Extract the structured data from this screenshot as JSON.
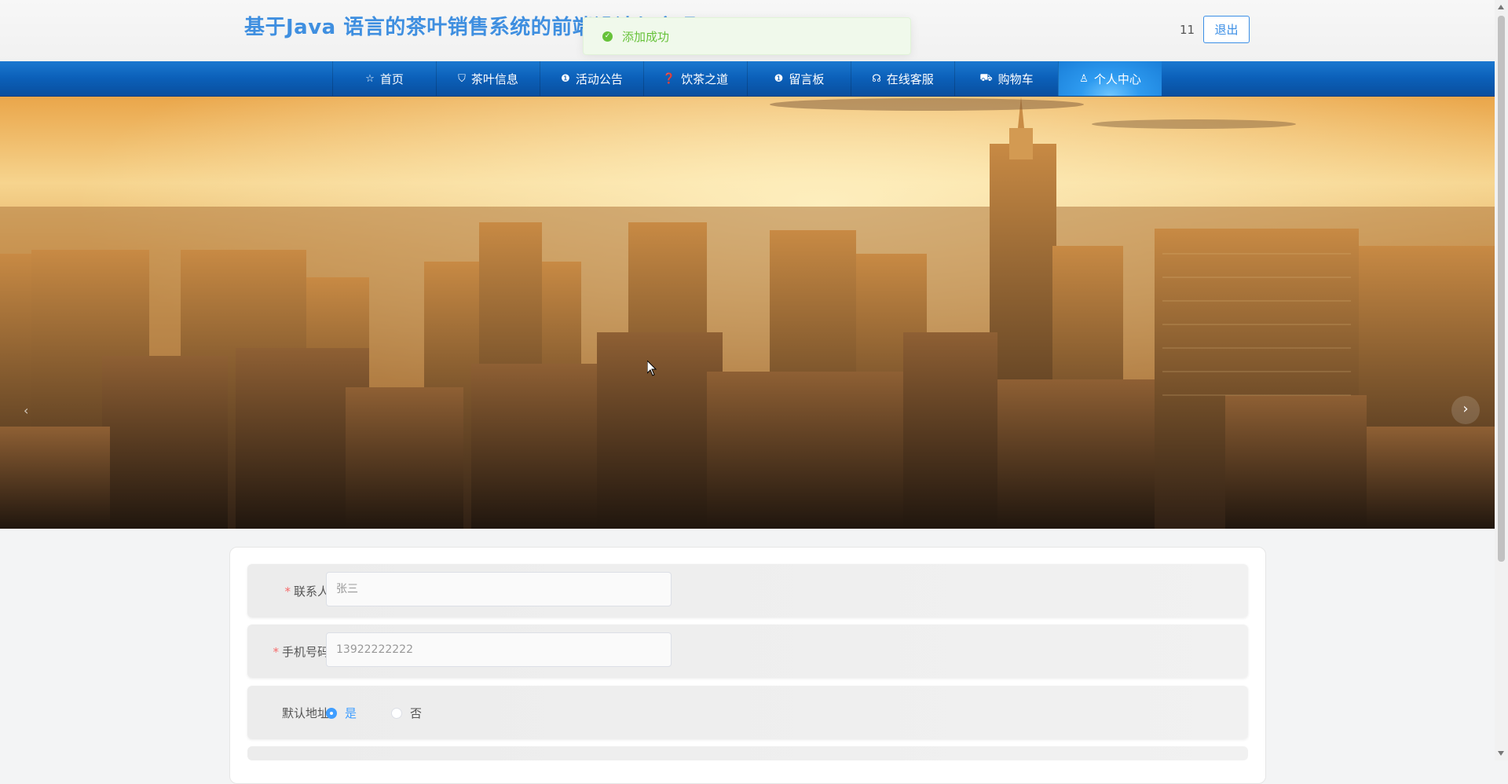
{
  "header": {
    "title": "基于Java 语言的茶叶销售系统的前端设计与实现",
    "username": "11",
    "logout_label": "退出"
  },
  "toast": {
    "message": "添加成功",
    "type": "success"
  },
  "nav": {
    "items": [
      {
        "label": "首页",
        "icon": "star-icon"
      },
      {
        "label": "茶叶信息",
        "icon": "bag-icon"
      },
      {
        "label": "活动公告",
        "icon": "info-icon"
      },
      {
        "label": "饮茶之道",
        "icon": "question-icon"
      },
      {
        "label": "留言板",
        "icon": "info-icon"
      },
      {
        "label": "在线客服",
        "icon": "headset-icon"
      },
      {
        "label": "购物车",
        "icon": "cart-icon"
      },
      {
        "label": "个人中心",
        "icon": "user-icon",
        "active": true
      }
    ]
  },
  "carousel": {
    "slide_count": 3,
    "active_index": 2
  },
  "form": {
    "contact": {
      "label": "联系人",
      "required": true,
      "placeholder": "张三"
    },
    "phone": {
      "label": "手机号码",
      "required": true,
      "placeholder": "13922222222"
    },
    "default_address": {
      "label": "默认地址",
      "options": [
        "是",
        "否"
      ],
      "selected": "是"
    }
  },
  "colors": {
    "brand": "#3f8fe0",
    "nav": "#0b5fb8",
    "success": "#67c23a",
    "primary": "#409eff",
    "required": "#f56c6c"
  }
}
